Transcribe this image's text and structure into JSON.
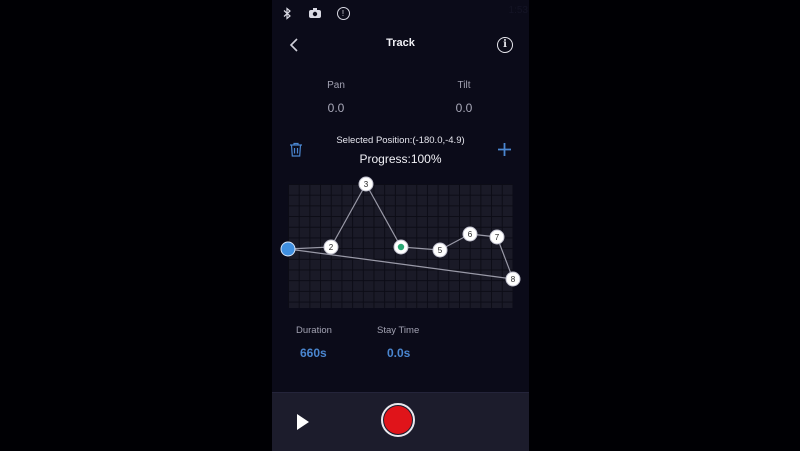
{
  "status_bar": {
    "icons": [
      "bluetooth-icon",
      "camera-icon",
      "alarm-icon"
    ],
    "right_text": "1:53"
  },
  "header": {
    "title": "Track",
    "back_icon": "chevron-left-icon",
    "info_icon": "info-icon"
  },
  "angles": {
    "pan_label": "Pan",
    "pan_value": "0.0",
    "tilt_label": "Tilt",
    "tilt_value": "0.0"
  },
  "selection": {
    "selected_position": "Selected Position:(-180.0,-4.9)",
    "progress": "Progress:100%",
    "progress_percent": 100,
    "delete_icon": "trash-icon",
    "add_icon": "plus-icon"
  },
  "track": {
    "points": [
      {
        "label": "",
        "type": "start"
      },
      {
        "label": "2",
        "type": "normal"
      },
      {
        "label": "3",
        "type": "normal"
      },
      {
        "label": "",
        "type": "current"
      },
      {
        "label": "5",
        "type": "normal"
      },
      {
        "label": "6",
        "type": "normal"
      },
      {
        "label": "7",
        "type": "normal"
      },
      {
        "label": "8",
        "type": "normal"
      }
    ]
  },
  "stats": {
    "duration_label": "Duration",
    "duration_value": "660s",
    "stay_label": "Stay Time",
    "stay_value": "0.0s"
  },
  "controls": {
    "play_icon": "play-icon",
    "record_icon": "record-icon"
  },
  "colors": {
    "accent": "#4a86d0",
    "record": "#e0141a",
    "current_point": "#2aa774",
    "start_point": "#3f8fe0"
  }
}
